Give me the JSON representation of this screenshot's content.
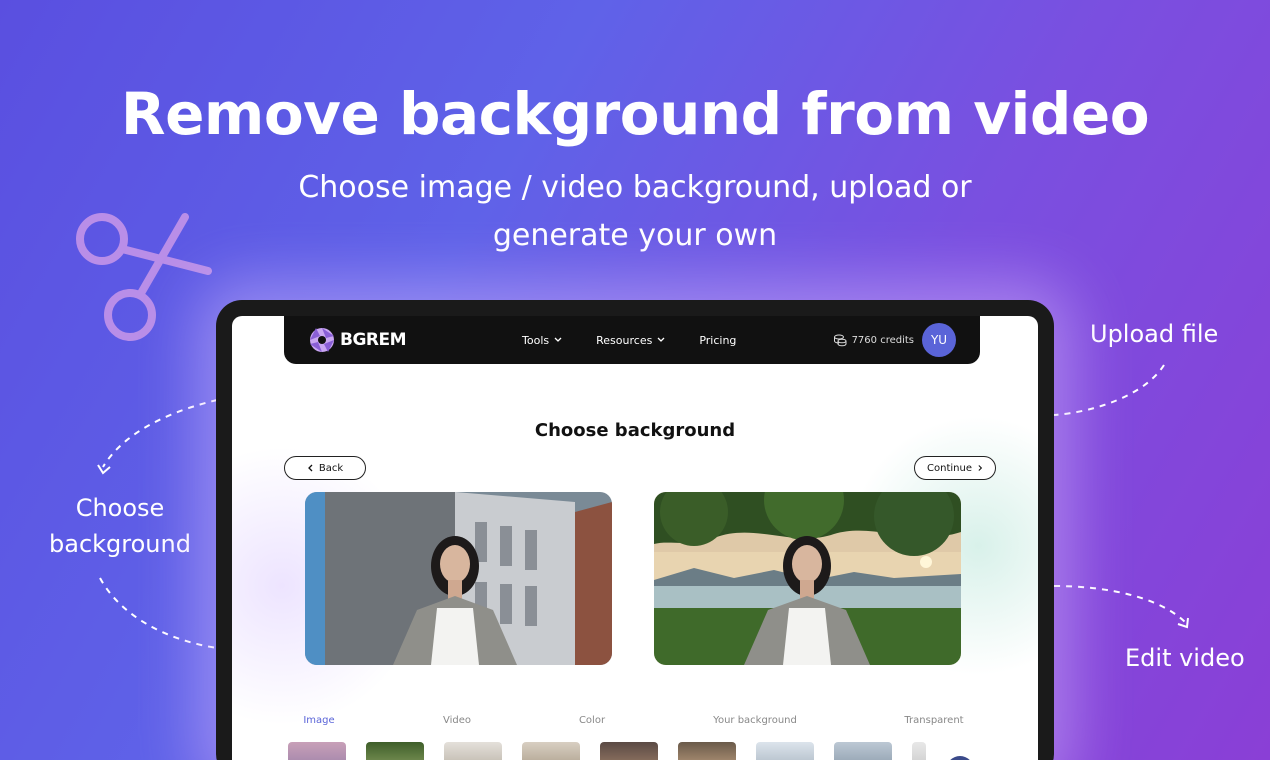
{
  "hero": {
    "title": "Remove background from video",
    "subtitle": "Choose image / video background, upload or generate your own"
  },
  "side_labels": {
    "upload": "Upload file",
    "choose": "Choose background",
    "edit": "Edit video"
  },
  "app": {
    "logo_text": "BGREM",
    "nav": [
      {
        "label": "Tools",
        "dropdown": true
      },
      {
        "label": "Resources",
        "dropdown": true
      },
      {
        "label": "Pricing",
        "dropdown": false
      }
    ],
    "credits": "7760 credits",
    "avatar_initials": "YU",
    "page_title": "Choose background",
    "back_label": "Back",
    "continue_label": "Continue",
    "tabs": [
      "Image",
      "Video",
      "Color",
      "Your background",
      "Transparent"
    ],
    "active_tab": "Image"
  },
  "colors": {
    "accent": "#5a64d8",
    "navbar": "#111111",
    "decor": "#b98ee8"
  }
}
